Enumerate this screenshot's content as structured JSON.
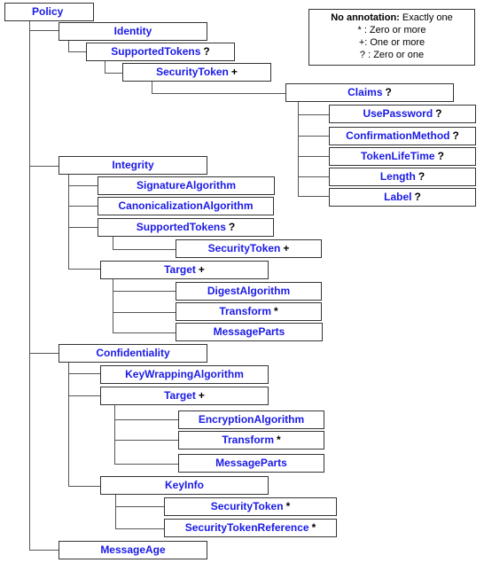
{
  "legend": {
    "line1_bold": "No annotation:",
    "line1_rest": " Exactly one",
    "line2": "* : Zero or more",
    "line3": "+:  One or more",
    "line4": "? :  Zero or one"
  },
  "nodes": {
    "policy": {
      "name": "Policy",
      "mult": ""
    },
    "identity": {
      "name": "Identity",
      "mult": ""
    },
    "id_supported_tokens": {
      "name": "SupportedTokens",
      "mult": "?"
    },
    "id_security_token": {
      "name": "SecurityToken",
      "mult": "+"
    },
    "claims": {
      "name": "Claims",
      "mult": "?"
    },
    "use_password": {
      "name": "UsePassword",
      "mult": "?"
    },
    "confirmation_method": {
      "name": "ConfirmationMethod",
      "mult": "?"
    },
    "token_lifetime": {
      "name": "TokenLifeTime",
      "mult": "?"
    },
    "length": {
      "name": "Length",
      "mult": "?"
    },
    "label": {
      "name": "Label",
      "mult": "?"
    },
    "integrity": {
      "name": "Integrity",
      "mult": ""
    },
    "signature_algorithm": {
      "name": "SignatureAlgorithm",
      "mult": ""
    },
    "canonicalization_algorithm": {
      "name": "CanonicalizationAlgorithm",
      "mult": ""
    },
    "int_supported_tokens": {
      "name": "SupportedTokens",
      "mult": "?"
    },
    "int_security_token": {
      "name": "SecurityToken",
      "mult": "+"
    },
    "int_target": {
      "name": "Target",
      "mult": "+"
    },
    "digest_algorithm": {
      "name": "DigestAlgorithm",
      "mult": ""
    },
    "int_transform": {
      "name": "Transform",
      "mult": "*"
    },
    "int_message_parts": {
      "name": "MessageParts",
      "mult": ""
    },
    "confidentiality": {
      "name": "Confidentiality",
      "mult": ""
    },
    "key_wrapping_algorithm": {
      "name": "KeyWrappingAlgorithm",
      "mult": ""
    },
    "conf_target": {
      "name": "Target",
      "mult": "+"
    },
    "encryption_algorithm": {
      "name": "EncryptionAlgorithm",
      "mult": ""
    },
    "conf_transform": {
      "name": "Transform",
      "mult": "*"
    },
    "conf_message_parts": {
      "name": "MessageParts",
      "mult": ""
    },
    "key_info": {
      "name": "KeyInfo",
      "mult": ""
    },
    "ki_security_token": {
      "name": "SecurityToken",
      "mult": "*"
    },
    "security_token_reference": {
      "name": "SecurityTokenReference",
      "mult": "*"
    },
    "message_age": {
      "name": "MessageAge",
      "mult": ""
    }
  }
}
